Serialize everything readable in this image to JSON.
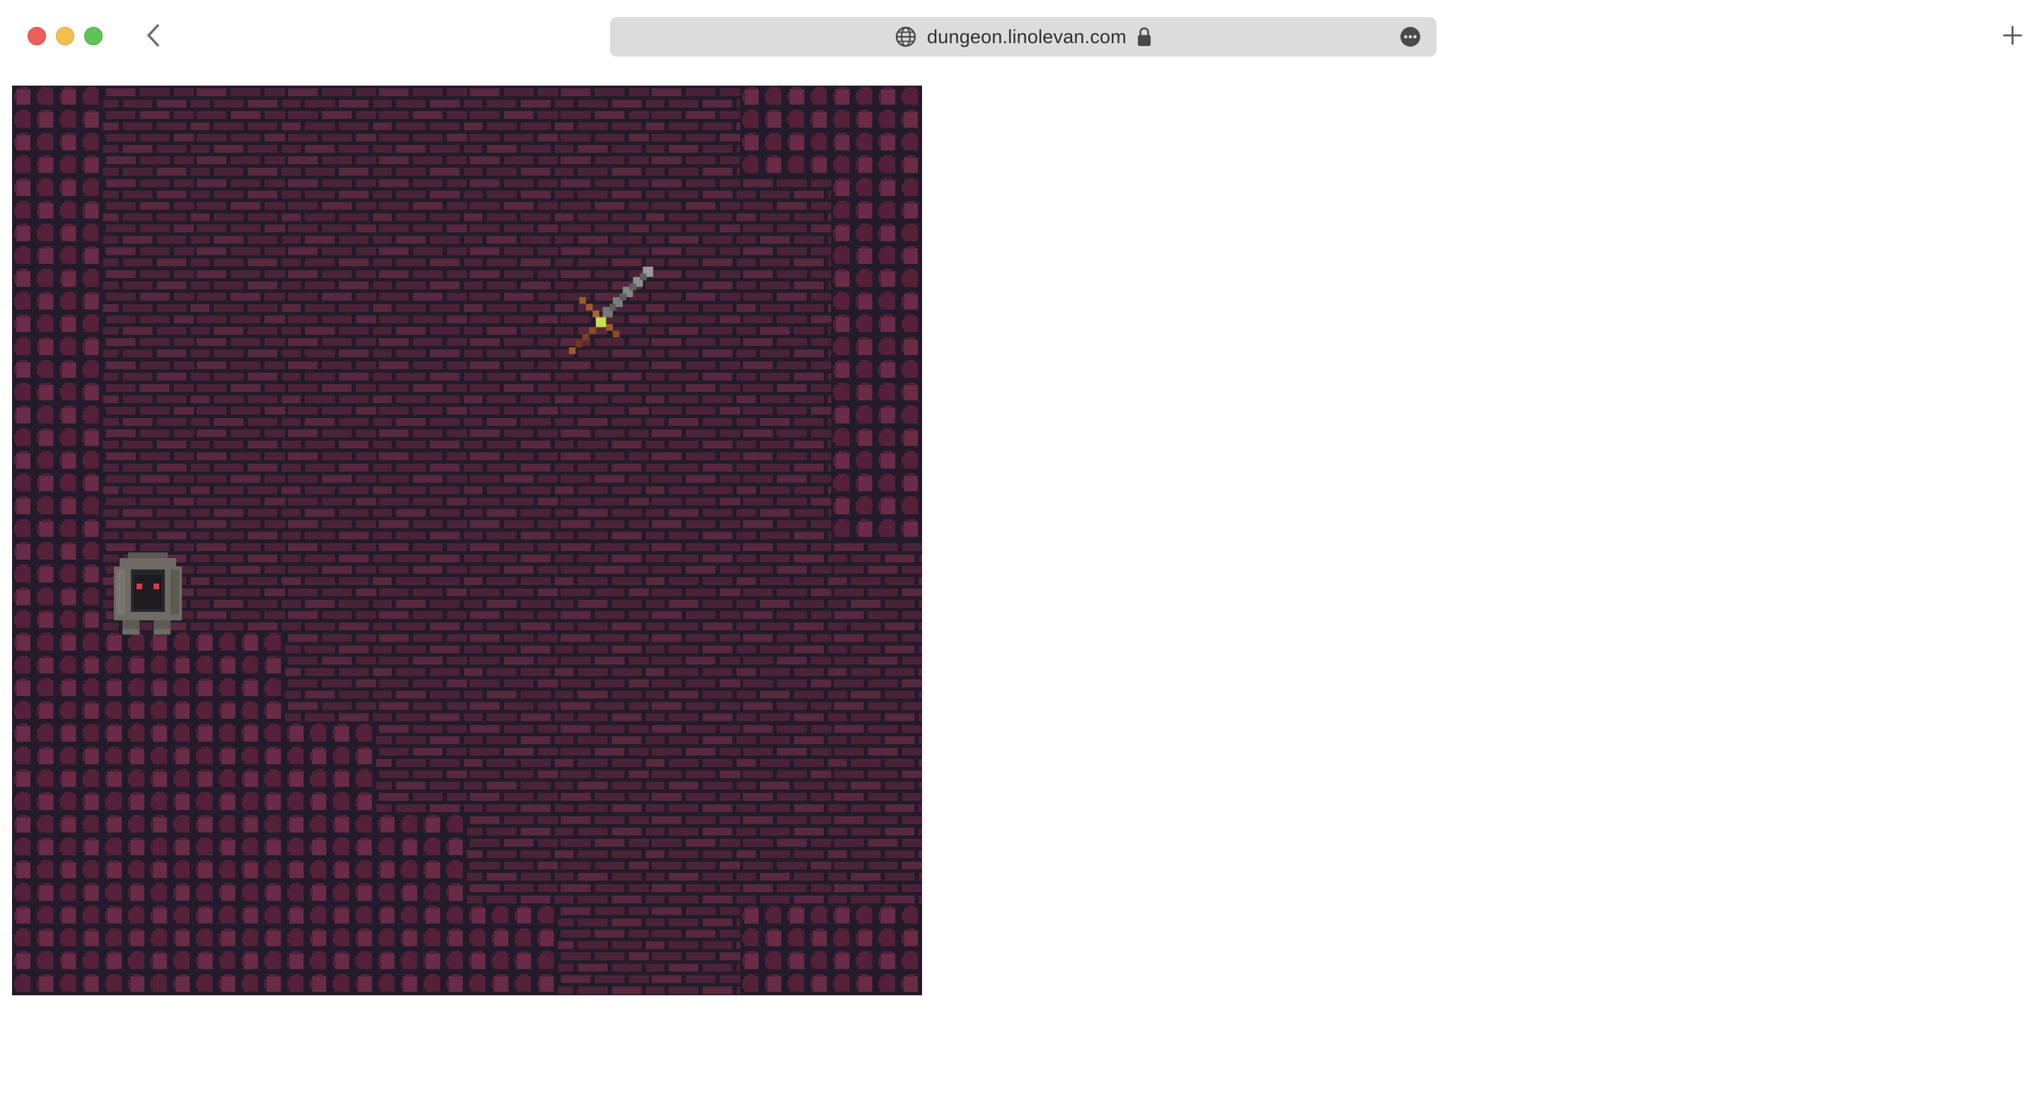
{
  "browser": {
    "url": "dungeon.linolevan.com",
    "icons": {
      "site": "globe-icon",
      "security": "lock-icon",
      "menu": "more-icon",
      "back": "chevron-left-icon",
      "new_tab": "plus-icon"
    },
    "colors": {
      "close": "#ee5f57",
      "minimize": "#f5bf4f",
      "zoom": "#5fc454",
      "address_bar": "#dcdcdc"
    }
  },
  "game": {
    "tile_types": [
      "brick-floor",
      "cobblestone-wall"
    ],
    "entities": [
      {
        "type": "sword",
        "icon": "sword-icon"
      },
      {
        "type": "hooded-creature",
        "icon": "ghost-icon"
      }
    ],
    "colors": {
      "brick": "#4b2338",
      "brick_light": "#58283f",
      "mortar": "#231b2b",
      "stone": "#552138",
      "stone_light": "#6a2b46",
      "sword_blade": "#8d8d8d",
      "sword_hilt": "#9c5a2b",
      "sword_gem": "#c8e04a",
      "creature_cloak": "#6e6b63",
      "creature_eyes": "#e03a3a"
    }
  }
}
